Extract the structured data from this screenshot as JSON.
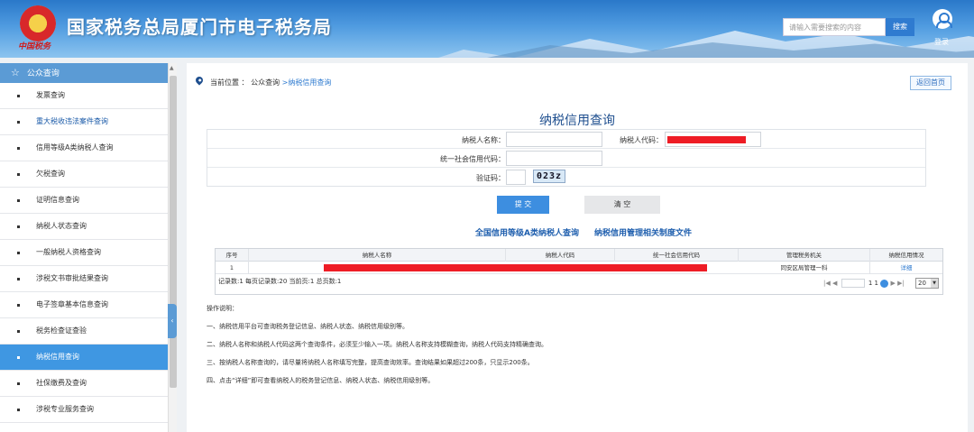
{
  "header": {
    "site_title": "国家税务总局厦门市电子税务局",
    "emblem_text": "中国税务",
    "search_placeholder": "请输入需要搜索的内容",
    "search_button": "搜索",
    "login": "登录"
  },
  "sidebar": {
    "section_title": "公众查询",
    "items": [
      {
        "label": "发票查询"
      },
      {
        "label": "重大税收违法案件查询"
      },
      {
        "label": "信用等级A类纳税人查询"
      },
      {
        "label": "欠税查询"
      },
      {
        "label": "证明信息查询"
      },
      {
        "label": "纳税人状态查询"
      },
      {
        "label": "一般纳税人资格查询"
      },
      {
        "label": "涉税文书审批结果查询"
      },
      {
        "label": "电子签章基本信息查询"
      },
      {
        "label": "税务检查证查验"
      },
      {
        "label": "纳税信用查询"
      },
      {
        "label": "社保缴费及查询"
      },
      {
        "label": "涉税专业服务查询"
      }
    ]
  },
  "breadcrumb": {
    "prefix": "当前位置 ：",
    "level1": "公众查询",
    "current": ">纳税信用查询"
  },
  "home_button": "返回首页",
  "page_title": "纳税信用查询",
  "form": {
    "name_label": "纳税人名称：",
    "code_label": "纳税人代码：",
    "uscc_label": "统一社会信用代码：",
    "captcha_label": "验证码：",
    "captcha_value": "023z"
  },
  "buttons": {
    "submit": "提 交",
    "clear": "清 空"
  },
  "links": {
    "a_class": "全国信用等级A类纳税人查询",
    "policy": "纳税信用管理相关制度文件"
  },
  "grid": {
    "columns": [
      "序号",
      "纳税人名称",
      "纳税人代码",
      "统一社会信用代码",
      "管理税务机关",
      "纳税信用情况"
    ],
    "rows": [
      {
        "index": "1",
        "authority": "同安区局管理一科",
        "detail": "详细"
      }
    ],
    "footer": "记录数:1 每页记录数:20 当前页:1 总页数:1",
    "pager_first": "|◀",
    "pager_prev": "◀",
    "pager_page": "1",
    "pager_of": "1",
    "pager_next": "▶",
    "pager_last": "▶|",
    "page_size": "20"
  },
  "notes": {
    "title": "操作说明：",
    "lines": [
      "一、纳税信用平台可查询税务登记信息、纳税人状态、纳税信用级别等。",
      "二、纳税人名称和纳税人代码这两个查询条件，必须至少输入一项。纳税人名称支持模糊查询，纳税人代码支持精确查询。",
      "三、按纳税人名称查询的，请尽量将纳税人名称填写完整，提高查询效率。查询结果如果超过200条，只显示200条。",
      "四、点击“详细”即可查看纳税人的税务登记信息、纳税人状态、纳税信用级别等。"
    ]
  },
  "colors": {
    "accent": "#3d8ee0",
    "sidebar_header": "#5b9bd5",
    "redaction": "#ee1c25"
  }
}
